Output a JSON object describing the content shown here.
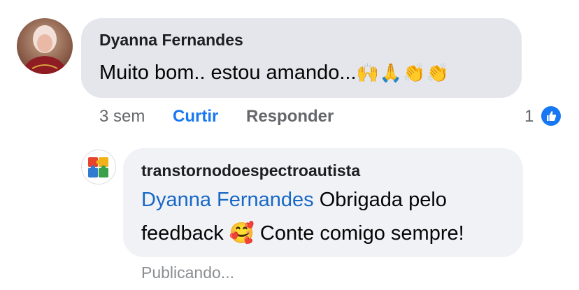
{
  "comment": {
    "author": "Dyanna Fernandes",
    "text": "Muito bom.. estou amando...",
    "emojis": "🙌🙏👏👏",
    "time": "3 sem",
    "like_label": "Curtir",
    "reply_label": "Responder",
    "reaction_count": "1",
    "reaction_icon": "thumbs-up-icon",
    "avatar_icon": "user-photo-avatar"
  },
  "reply": {
    "author": "transtornodoespectroautista",
    "mention": "Dyanna Fernandes",
    "text_before_emoji": " Obrigada pelo feedback ",
    "emoji": "🥰",
    "text_after_emoji": " Conte comigo sempre!",
    "status": "Publicando...",
    "avatar_icon": "puzzle-pieces-avatar"
  },
  "colors": {
    "link_blue": "#1877f2",
    "mention_blue": "#1868c7",
    "bubble_gray": "#e4e6eb",
    "bubble_light": "#f0f2f5",
    "meta_gray": "#65676b"
  }
}
